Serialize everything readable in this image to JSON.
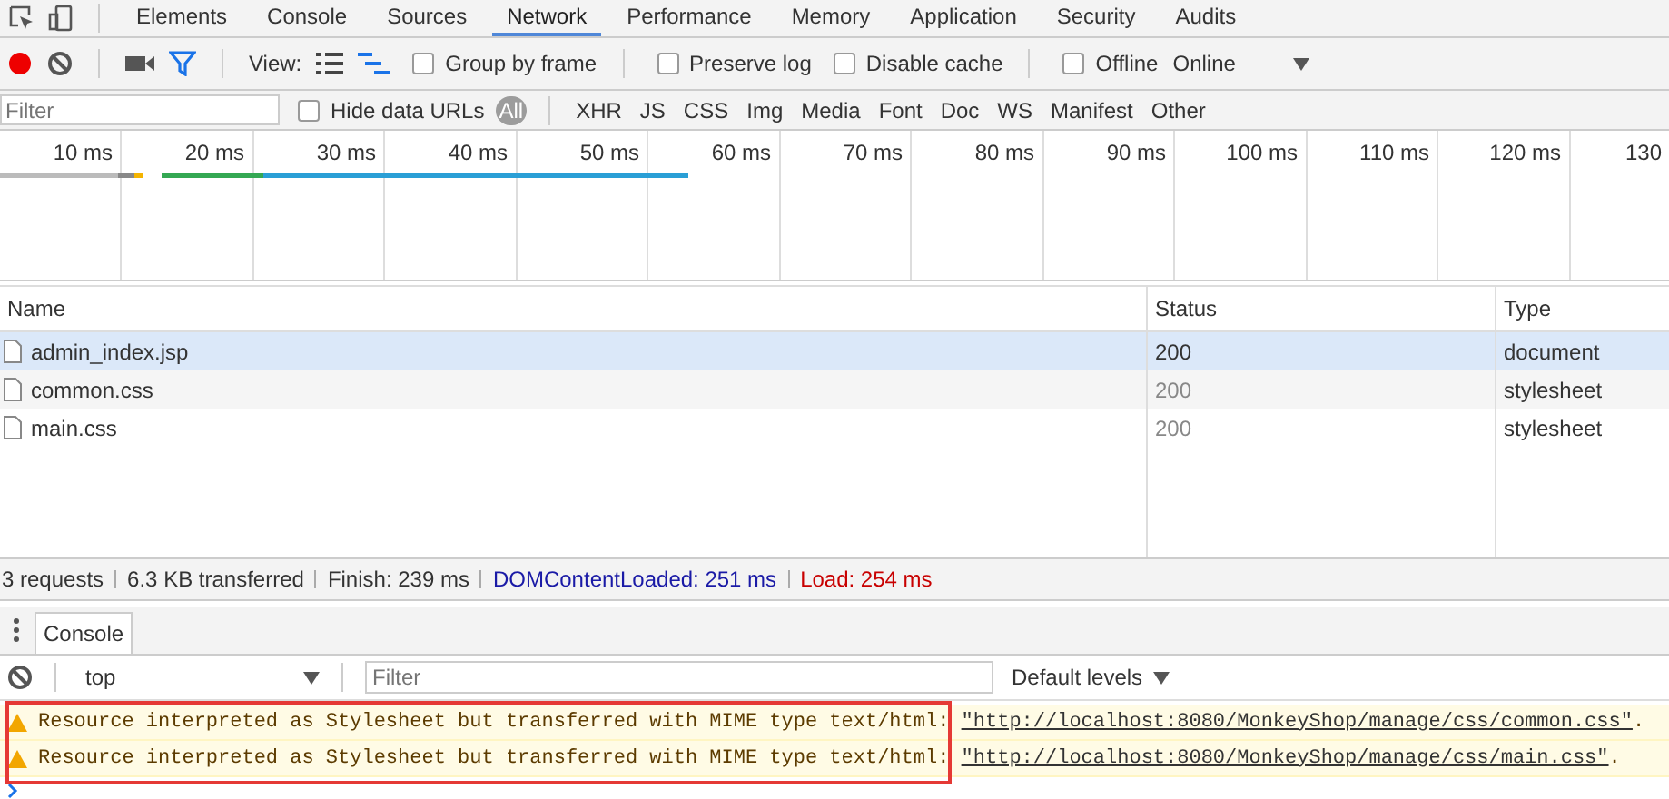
{
  "tabs": [
    {
      "label": "Elements",
      "selected": false
    },
    {
      "label": "Console",
      "selected": false
    },
    {
      "label": "Sources",
      "selected": false
    },
    {
      "label": "Network",
      "selected": true
    },
    {
      "label": "Performance",
      "selected": false
    },
    {
      "label": "Memory",
      "selected": false
    },
    {
      "label": "Application",
      "selected": false
    },
    {
      "label": "Security",
      "selected": false
    },
    {
      "label": "Audits",
      "selected": false
    }
  ],
  "toolbar": {
    "recording": true,
    "view_label": "View:",
    "checkboxes": [
      {
        "label": "Group by frame",
        "checked": false
      },
      {
        "label": "Preserve log",
        "checked": false
      },
      {
        "label": "Disable cache",
        "checked": false
      },
      {
        "label": "Offline",
        "checked": false
      }
    ],
    "throttling": "Online"
  },
  "filter_bar": {
    "placeholder": "Filter",
    "hide_data_urls": {
      "label": "Hide data URLs",
      "checked": false
    },
    "types": [
      {
        "label": "All",
        "selected": true
      },
      {
        "label": "XHR",
        "selected": false
      },
      {
        "label": "JS",
        "selected": false
      },
      {
        "label": "CSS",
        "selected": false
      },
      {
        "label": "Img",
        "selected": false
      },
      {
        "label": "Media",
        "selected": false
      },
      {
        "label": "Font",
        "selected": false
      },
      {
        "label": "Doc",
        "selected": false
      },
      {
        "label": "WS",
        "selected": false
      },
      {
        "label": "Manifest",
        "selected": false
      },
      {
        "label": "Other",
        "selected": false
      }
    ]
  },
  "overview": {
    "ticks": [
      "10 ms",
      "20 ms",
      "30 ms",
      "40 ms",
      "50 ms",
      "60 ms",
      "70 ms",
      "80 ms",
      "90 ms",
      "100 ms",
      "110 ms",
      "120 ms",
      "130"
    ]
  },
  "table": {
    "columns": [
      "Name",
      "Status",
      "Type"
    ],
    "rows": [
      {
        "name": "admin_index.jsp",
        "status": "200",
        "type": "document",
        "selected": true
      },
      {
        "name": "common.css",
        "status": "200",
        "type": "stylesheet",
        "selected": false
      },
      {
        "name": "main.css",
        "status": "200",
        "type": "stylesheet",
        "selected": false
      }
    ]
  },
  "status_bar": [
    {
      "text": "3 requests",
      "color": "#333333"
    },
    {
      "text": "6.3 KB transferred",
      "color": "#333333"
    },
    {
      "text": "Finish: 239 ms",
      "color": "#333333"
    },
    {
      "text": "DOMContentLoaded: 251 ms",
      "color": "#1a1aa6"
    },
    {
      "text": "Load: 254 ms",
      "color": "#c80000"
    }
  ],
  "drawer": {
    "tab": "Console",
    "context": "top",
    "filter_placeholder": "Filter",
    "levels": "Default levels"
  },
  "messages": [
    {
      "text": "Resource interpreted as Stylesheet but transferred with MIME type text/html: ",
      "url": "\"http://localhost:8080/MonkeyShop/manage/css/common.css\"",
      "tail": "."
    },
    {
      "text": "Resource interpreted as Stylesheet but transferred with MIME type text/html: ",
      "url": "\"http://localhost:8080/MonkeyShop/manage/css/main.css\"",
      "tail": "."
    }
  ]
}
